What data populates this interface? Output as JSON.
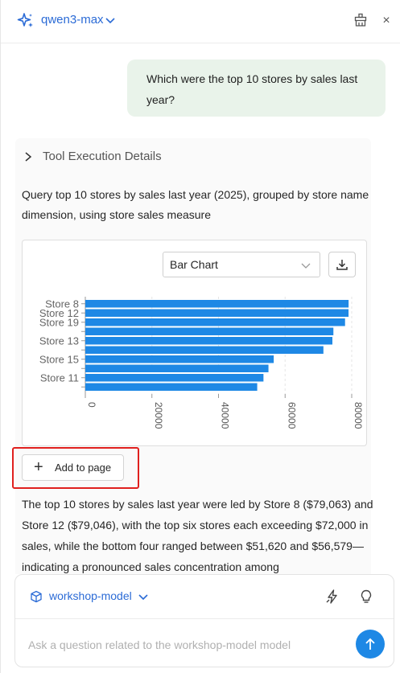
{
  "header": {
    "model": "qwen3-max",
    "close": "×"
  },
  "user_message": "Which were the top 10 stores by sales last year?",
  "tool_details_label": "Tool Execution Details",
  "query_description": "Query top 10 stores by sales last year (2025), grouped by store name dimension, using store sales measure",
  "chart_controls": {
    "chart_type": "Bar Chart"
  },
  "add_to_page_label": "Add to page",
  "summary": "The top 10 stores by sales last year were led by Store 8 ($79,063) and Store 12 ($79,046), with the top six stores each exceeding $72,000 in sales, while the bottom four ranged between $51,620 and $56,579—indicating a pronounced sales concentration among",
  "composer": {
    "model": "workshop-model",
    "placeholder": "Ask a question related to the workshop-model model"
  },
  "colors": {
    "accent": "#2b6bd6",
    "bar": "#1e88e5",
    "send": "#1e88e5",
    "highlight": "#e0201e"
  },
  "chart_data": {
    "type": "bar",
    "orientation": "horizontal",
    "categories": [
      "Store 8",
      "Store 12",
      "Store 19",
      "",
      "Store 13",
      "",
      "Store 15",
      "",
      "Store 11",
      ""
    ],
    "values": [
      79063,
      79046,
      78000,
      74500,
      74200,
      71500,
      56579,
      55000,
      53500,
      51620
    ],
    "xlim": [
      0,
      80000
    ],
    "x_ticks": [
      "0",
      "20000",
      "40000",
      "60000",
      "80000"
    ],
    "x_tick_values": [
      0,
      20000,
      40000,
      60000,
      80000
    ],
    "y_tick_labels": [
      "Store 8",
      "Store 19",
      "Store 13",
      "Store 15",
      "Store 11"
    ],
    "grid": "vertical-dashed"
  }
}
